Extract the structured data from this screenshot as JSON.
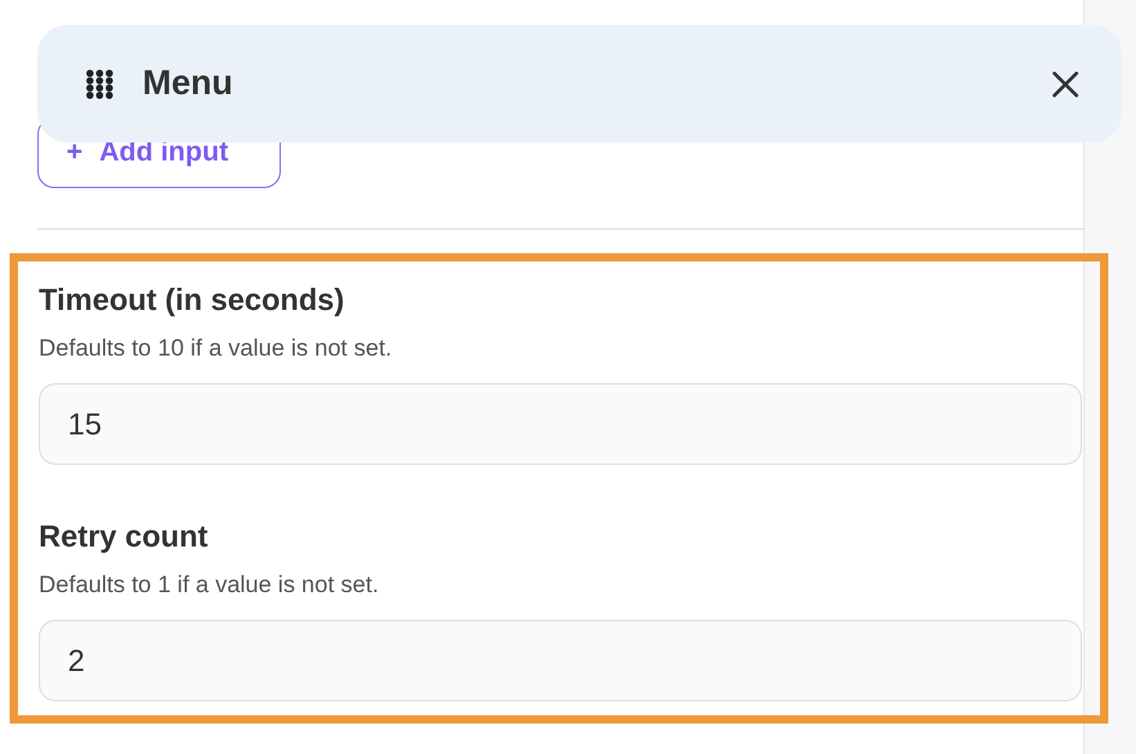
{
  "menu_bar": {
    "title": "Menu"
  },
  "add_input_button": {
    "icon": "+",
    "label": "Add input"
  },
  "settings": [
    {
      "label": "Timeout (in seconds)",
      "help": "Defaults to 10 if a value is not set.",
      "value": "15"
    },
    {
      "label": "Retry count",
      "help": "Defaults to 1 if a value is not set.",
      "value": "2"
    }
  ]
}
